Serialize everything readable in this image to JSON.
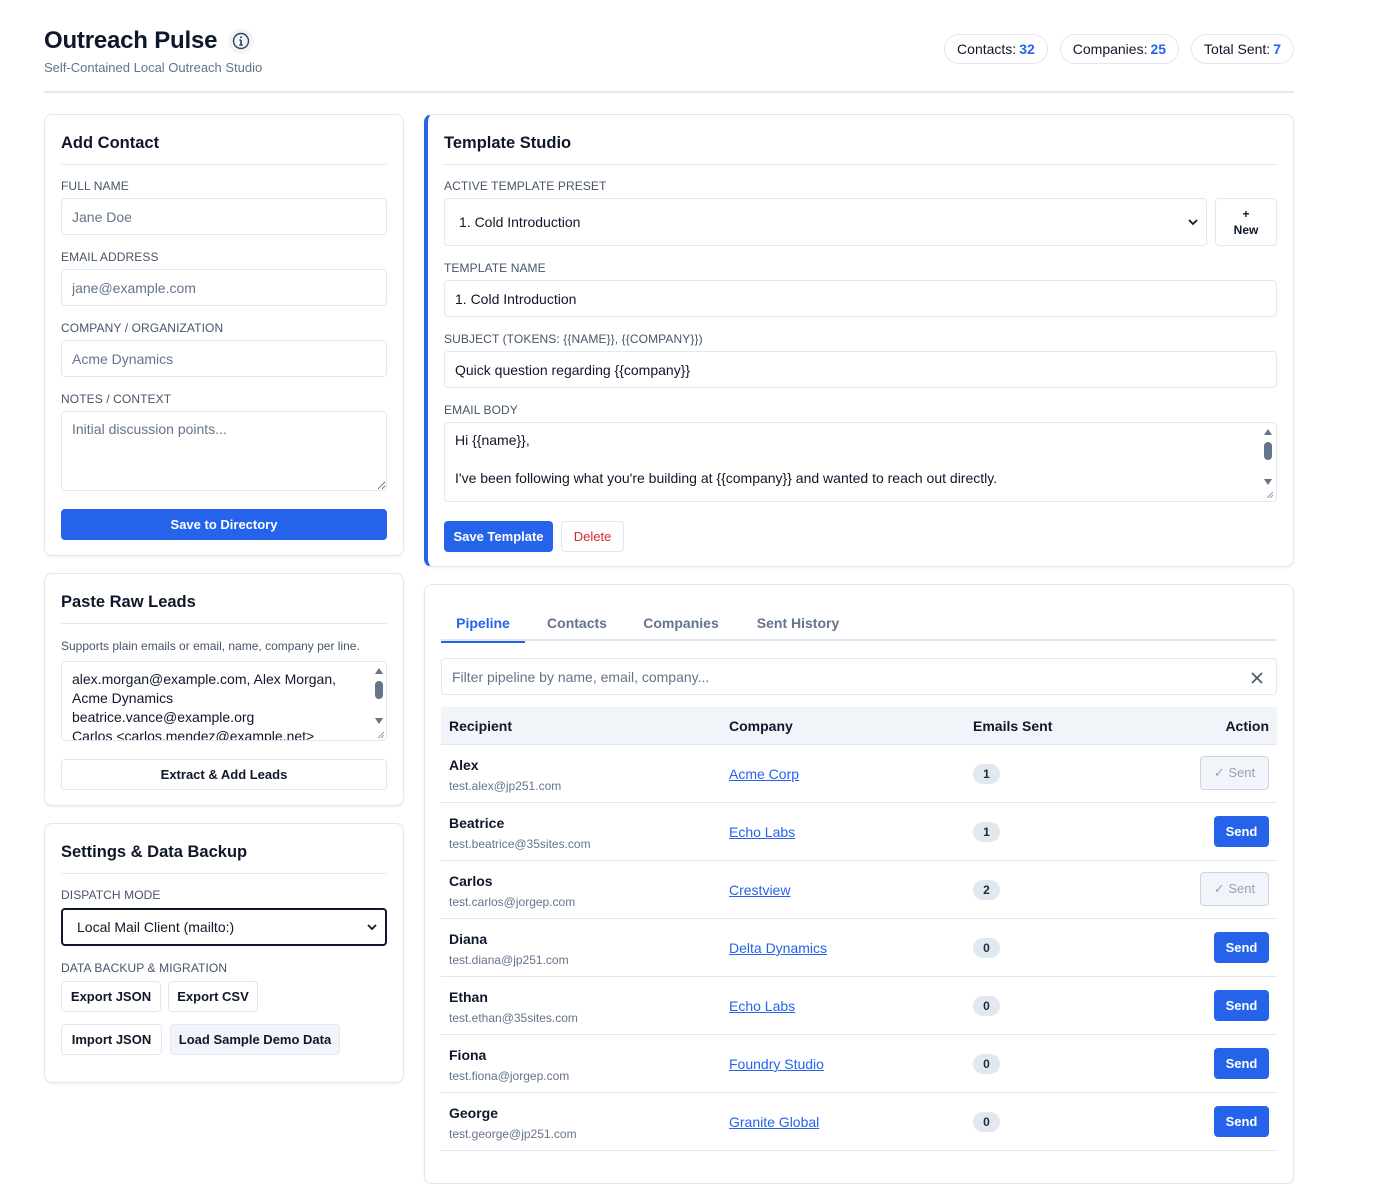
{
  "app": {
    "title": "Outreach Pulse",
    "subtitle": "Self-Contained Local Outreach Studio",
    "info_icon": "info-icon"
  },
  "stats": [
    {
      "label": "Contacts:",
      "value": "32"
    },
    {
      "label": "Companies:",
      "value": "25"
    },
    {
      "label": "Total Sent:",
      "value": "7"
    }
  ],
  "add_contact": {
    "title": "Add Contact",
    "full_name_label": "FULL NAME",
    "full_name_placeholder": "Jane Doe",
    "email_label": "EMAIL ADDRESS",
    "email_placeholder": "jane@example.com",
    "company_label": "COMPANY / ORGANIZATION",
    "company_placeholder": "Acme Dynamics",
    "notes_label": "NOTES / CONTEXT",
    "notes_placeholder": "Initial discussion points...",
    "save_button": "Save to Directory"
  },
  "raw_leads": {
    "title": "Paste Raw Leads",
    "hint": "Supports plain emails or email, name, company per line.",
    "value": "alex.morgan@example.com, Alex Morgan, Acme Dynamics\nbeatrice.vance@example.org\nCarlos <carlos.mendez@example.net>",
    "extract_button": "Extract & Add Leads"
  },
  "settings": {
    "title": "Settings & Data Backup",
    "dispatch_label": "DISPATCH MODE",
    "dispatch_value": "Local Mail Client (mailto:)",
    "backup_label": "DATA BACKUP & MIGRATION",
    "export_json": "Export JSON",
    "export_csv": "Export CSV",
    "import_json": "Import JSON",
    "load_demo": "Load Sample Demo Data"
  },
  "template_studio": {
    "title": "Template Studio",
    "preset_label": "ACTIVE TEMPLATE PRESET",
    "preset_value": "1. Cold Introduction",
    "new_plus": "+",
    "new_label": "New",
    "name_label": "TEMPLATE NAME",
    "name_value": "1. Cold Introduction",
    "subject_label": "SUBJECT (TOKENS: {{NAME}}, {{COMPANY}})",
    "subject_value": "Quick question regarding {{company}}",
    "body_label": "EMAIL BODY",
    "body_value": "Hi {{name}},\n\nI've been following what you're building at {{company}} and wanted to reach out directly.",
    "save_button": "Save Template",
    "delete_button": "Delete",
    "accent_color": "#2563eb"
  },
  "pipeline": {
    "tabs": [
      "Pipeline",
      "Contacts",
      "Companies",
      "Sent History"
    ],
    "active_tab": "Pipeline",
    "filter_placeholder": "Filter pipeline by name, email, company...",
    "columns": [
      "Recipient",
      "Company",
      "Emails Sent",
      "Action"
    ],
    "rows": [
      {
        "name": "Alex",
        "email": "test.alex@jp251.com",
        "company": "Acme Corp",
        "sent": "1",
        "action": "✓ Sent",
        "is_sent": true
      },
      {
        "name": "Beatrice",
        "email": "test.beatrice@35sites.com",
        "company": "Echo Labs",
        "sent": "1",
        "action": "Send",
        "is_sent": false
      },
      {
        "name": "Carlos",
        "email": "test.carlos@jorgep.com",
        "company": "Crestview",
        "sent": "2",
        "action": "✓ Sent",
        "is_sent": true
      },
      {
        "name": "Diana",
        "email": "test.diana@jp251.com",
        "company": "Delta Dynamics",
        "sent": "0",
        "action": "Send",
        "is_sent": false
      },
      {
        "name": "Ethan",
        "email": "test.ethan@35sites.com",
        "company": "Echo Labs",
        "sent": "0",
        "action": "Send",
        "is_sent": false
      },
      {
        "name": "Fiona",
        "email": "test.fiona@jorgep.com",
        "company": "Foundry Studio",
        "sent": "0",
        "action": "Send",
        "is_sent": false
      },
      {
        "name": "George",
        "email": "test.george@jp251.com",
        "company": "Granite Global",
        "sent": "0",
        "action": "Send",
        "is_sent": false
      }
    ]
  }
}
